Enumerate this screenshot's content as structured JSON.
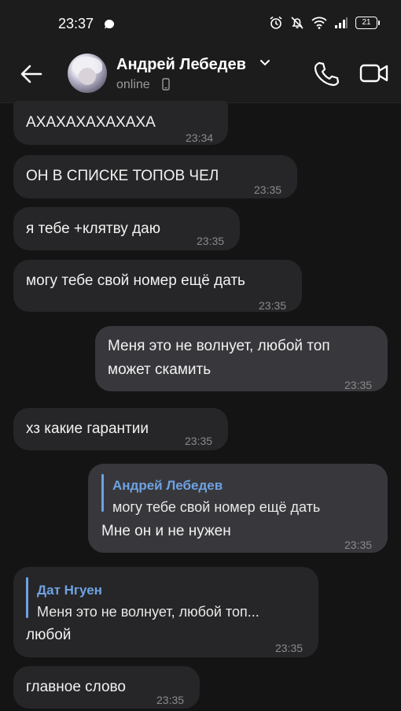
{
  "status_bar": {
    "time": "23:37",
    "battery": "21"
  },
  "header": {
    "contact_name": "Андрей Лебедев",
    "presence": "online"
  },
  "messages": [
    {
      "dir": "in",
      "text": "АХАХАХАХАХАХА",
      "time": "23:34"
    },
    {
      "dir": "in",
      "text": "ОН В СПИСКЕ ТОПОВ ЧЕЛ",
      "time": "23:35"
    },
    {
      "dir": "in",
      "text": "я тебе +клятву даю",
      "time": "23:35"
    },
    {
      "dir": "in",
      "text": "могу тебе свой номер ещё дать",
      "time": "23:35"
    },
    {
      "dir": "out",
      "text_line1": "Меня это не волнует, любой топ",
      "text_line2": "может скамить",
      "time": "23:35"
    },
    {
      "dir": "in",
      "text": "хз какие гарантии",
      "time": "23:35"
    },
    {
      "dir": "out",
      "reply_name": "Андрей Лебедев",
      "reply_text": "могу тебе свой номер ещё дать",
      "text": "Мне он и не нужен",
      "time": "23:35"
    },
    {
      "dir": "in",
      "reply_name": "Дат Нгуен",
      "reply_text": "Меня это не волнует, любой топ...",
      "text": "любой",
      "time": "23:35"
    },
    {
      "dir": "in",
      "text": "главное слово",
      "time": "23:35"
    }
  ]
}
